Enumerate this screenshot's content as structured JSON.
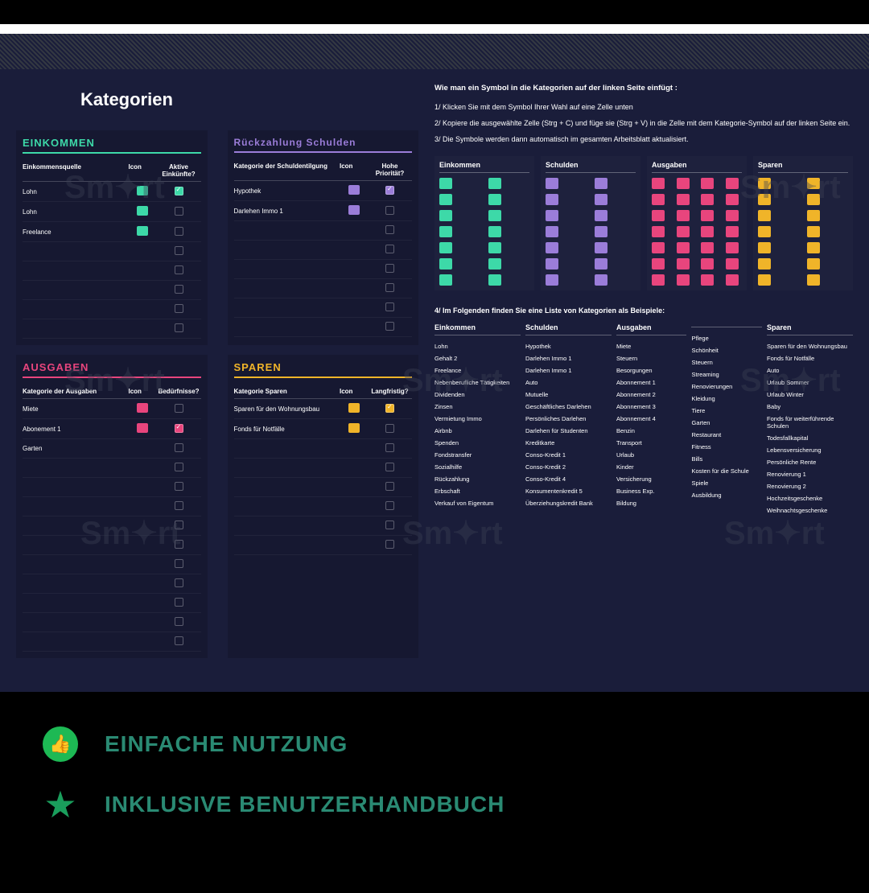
{
  "title": "Kategorien",
  "sections": {
    "einkommen": {
      "header": "EINKOMMEN",
      "cols": [
        "Einkommensquelle",
        "Icon",
        "Aktive Einkünfte?"
      ],
      "rows": [
        {
          "label": "Lohn",
          "icon": true,
          "checked": true
        },
        {
          "label": "Lohn",
          "icon": true,
          "checked": false
        },
        {
          "label": "Freelance",
          "icon": true,
          "checked": false
        },
        {
          "label": "",
          "icon": false,
          "checked": false
        },
        {
          "label": "",
          "icon": false,
          "checked": false
        },
        {
          "label": "",
          "icon": false,
          "checked": false
        },
        {
          "label": "",
          "icon": false,
          "checked": false
        },
        {
          "label": "",
          "icon": false,
          "checked": false
        }
      ]
    },
    "schulden": {
      "header": "Rückzahlung Schulden",
      "cols": [
        "Kategorie der Schuldentilgung",
        "Icon",
        "Hohe Priorität?"
      ],
      "rows": [
        {
          "label": "Hypothek",
          "icon": true,
          "checked": true
        },
        {
          "label": "Darlehen Immo 1",
          "icon": true,
          "checked": false
        },
        {
          "label": "",
          "icon": false,
          "checked": false
        },
        {
          "label": "",
          "icon": false,
          "checked": false
        },
        {
          "label": "",
          "icon": false,
          "checked": false
        },
        {
          "label": "",
          "icon": false,
          "checked": false
        },
        {
          "label": "",
          "icon": false,
          "checked": false
        },
        {
          "label": "",
          "icon": false,
          "checked": false
        }
      ]
    },
    "ausgaben": {
      "header": "AUSGABEN",
      "cols": [
        "Kategorie der Ausgaben",
        "Icon",
        "Bedürfnisse?"
      ],
      "rows": [
        {
          "label": "Miete",
          "icon": true,
          "checked": false
        },
        {
          "label": "Abonement 1",
          "icon": true,
          "checked": true
        },
        {
          "label": "Garten",
          "icon": false,
          "checked": false
        },
        {
          "label": "",
          "icon": false,
          "checked": false
        },
        {
          "label": "",
          "icon": false,
          "checked": false
        },
        {
          "label": "",
          "icon": false,
          "checked": false
        },
        {
          "label": "",
          "icon": false,
          "checked": false
        },
        {
          "label": "",
          "icon": false,
          "checked": false
        },
        {
          "label": "",
          "icon": false,
          "checked": false
        },
        {
          "label": "",
          "icon": false,
          "checked": false
        },
        {
          "label": "",
          "icon": false,
          "checked": false
        },
        {
          "label": "",
          "icon": false,
          "checked": false
        },
        {
          "label": "",
          "icon": false,
          "checked": false
        }
      ]
    },
    "sparen": {
      "header": "SPAREN",
      "cols": [
        "Kategorie Sparen",
        "Icon",
        "Langfristig?"
      ],
      "rows": [
        {
          "label": "Sparen für den Wohnungsbau",
          "icon": true,
          "checked": true
        },
        {
          "label": "Fonds für Notfälle",
          "icon": true,
          "checked": false
        },
        {
          "label": "",
          "icon": false,
          "checked": false
        },
        {
          "label": "",
          "icon": false,
          "checked": false
        },
        {
          "label": "",
          "icon": false,
          "checked": false
        },
        {
          "label": "",
          "icon": false,
          "checked": false
        },
        {
          "label": "",
          "icon": false,
          "checked": false
        },
        {
          "label": "",
          "icon": false,
          "checked": false
        }
      ]
    }
  },
  "instructions": {
    "title": "Wie man ein Symbol in die Kategorien auf der linken Seite einfügt :",
    "steps": [
      "1/ Klicken Sie mit dem Symbol Ihrer Wahl auf eine Zelle unten",
      "2/ Kopiere die ausgewählte Zelle (Strg + C) und füge sie (Strg + V) in die Zelle mit dem Kategorie-Symbol auf der linken Seite ein.",
      "3/ Die Symbole werden dann automatisch im gesamten Arbeitsblatt aktualisiert."
    ]
  },
  "palette_headers": [
    "Einkommen",
    "Schulden",
    "Ausgaben",
    "Sparen"
  ],
  "palette_counts": [
    14,
    14,
    28,
    14
  ],
  "examples": {
    "title": "4/ Im Folgenden finden Sie eine Liste von Kategorien als Beispiele:",
    "cols": [
      {
        "head": "Einkommen",
        "items": [
          "Lohn",
          "Gehalt 2",
          "Freelance",
          "Nebenberufliche Tätigkeiten",
          "Dividenden",
          "Zinsen",
          "Vermietung Immo",
          "Airbnb",
          "Spenden",
          "Fondstransfer",
          "Sozialhilfe",
          "Rückzahlung",
          "Erbschaft",
          "Verkauf von Eigentum"
        ]
      },
      {
        "head": "Schulden",
        "items": [
          "Hypothek",
          "Darlehen Immo 1",
          "Darlehen Immo 1",
          "Auto",
          "Mutuelle",
          "Geschäftliches Darlehen",
          "Persönliches Darlehen",
          "Darlehen für Studenten",
          "Kreditkarte",
          "Conso-Kredit 1",
          "Conso-Kredit 2",
          "Conso-Kredit 4",
          "Konsumentenkredit 5",
          "Überziehungskredit Bank"
        ]
      },
      {
        "head": "Ausgaben",
        "items": [
          "Miete",
          "Steuern",
          "Besorgungen",
          "Abonnement 1",
          "Abonnement 2",
          "Abonnement 3",
          "Abonnement 4",
          "Benzin",
          "Transport",
          "Urlaub",
          "Kinder",
          "Versicherung",
          "Business Exp.",
          "Bildung"
        ]
      },
      {
        "head": "",
        "items": [
          "Pflege",
          "Schönheit",
          "Steuern",
          "Streaming",
          "Renovierungen",
          "Kleidung",
          "Tiere",
          "Garten",
          "Restaurant",
          "Fitness",
          "Bills",
          "Kosten für die Schule",
          "Spiele",
          "Ausbildung"
        ]
      },
      {
        "head": "Sparen",
        "items": [
          "Sparen für den Wohnungsbau",
          "Fonds für Notfälle",
          "Auto",
          "Urlaub Sommer",
          "Urlaub Winter",
          "Baby",
          "Fonds für weiterführende Schulen",
          "Todesfallkapital",
          "Lebensversicherung",
          "Persönliche Rente",
          "Renovierung 1",
          "Renovierung 2",
          "Hochzeitsgeschenke",
          "Weihnachtsgeschenke"
        ]
      }
    ]
  },
  "features": [
    "EINFACHE NUTZUNG",
    "INKLUSIVE BENUTZERHANDBUCH"
  ]
}
